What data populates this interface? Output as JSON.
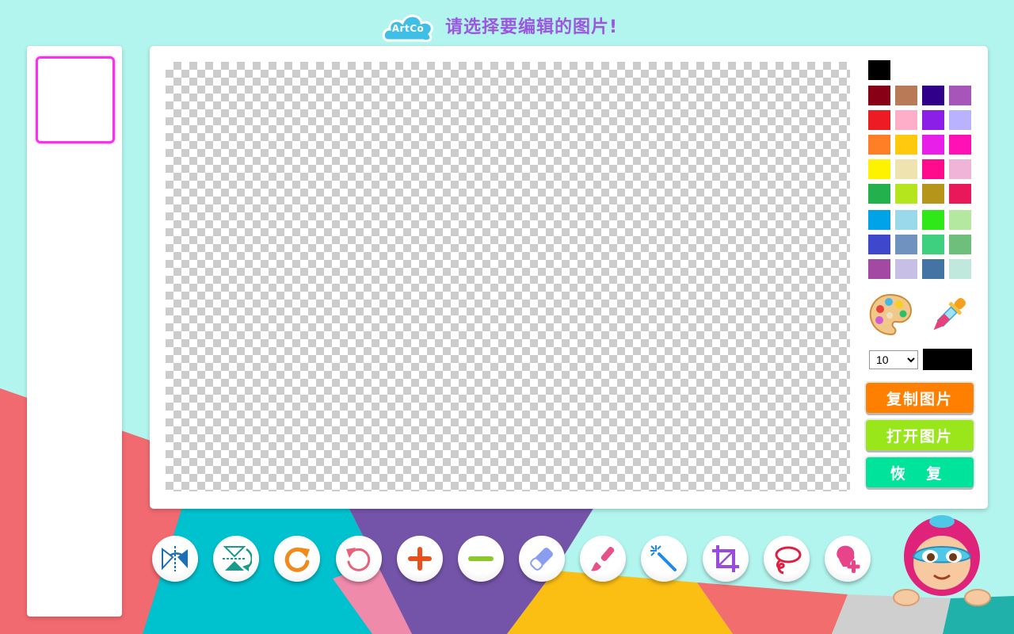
{
  "header": {
    "logo_text": "ArtCo",
    "title": "请选择要编辑的图片!"
  },
  "colors": {
    "background": "#b2f5ee",
    "thumbnail_border": "#ff2cf2",
    "title": "#9b57e0"
  },
  "color_palette": [
    "#000000",
    "#880015",
    "#b97a57",
    "#30008a",
    "#a855b9",
    "#ed1c24",
    "#ffaec9",
    "#8b1fe8",
    "#b9b3ff",
    "#ff7f27",
    "#ffc90e",
    "#e81fe8",
    "#ff11b5",
    "#fff200",
    "#efe4b0",
    "#ff0b8b",
    "#f0b4d9",
    "#22b14c",
    "#b5e61d",
    "#b5961a",
    "#e8185a",
    "#00a2e8",
    "#99d9ea",
    "#2ee81a",
    "#b4e8a0",
    "#3f48cc",
    "#7092be",
    "#3ed07f",
    "#6fbf7c",
    "#a349a4",
    "#c8bfe7",
    "#4474a4",
    "#c0e8dd"
  ],
  "brush": {
    "size_value": "10",
    "current_color": "#000000"
  },
  "buttons": {
    "copy_label": "复制图片",
    "open_label": "打开图片",
    "restore_label": "恢 复"
  },
  "toolbar": [
    {
      "name": "flip-horizontal"
    },
    {
      "name": "flip-vertical"
    },
    {
      "name": "rotate-clockwise"
    },
    {
      "name": "rotate-counterclockwise"
    },
    {
      "name": "zoom-in"
    },
    {
      "name": "zoom-out"
    },
    {
      "name": "eraser"
    },
    {
      "name": "brush"
    },
    {
      "name": "magic-wand"
    },
    {
      "name": "crop"
    },
    {
      "name": "lasso"
    },
    {
      "name": "add-sticker"
    }
  ]
}
